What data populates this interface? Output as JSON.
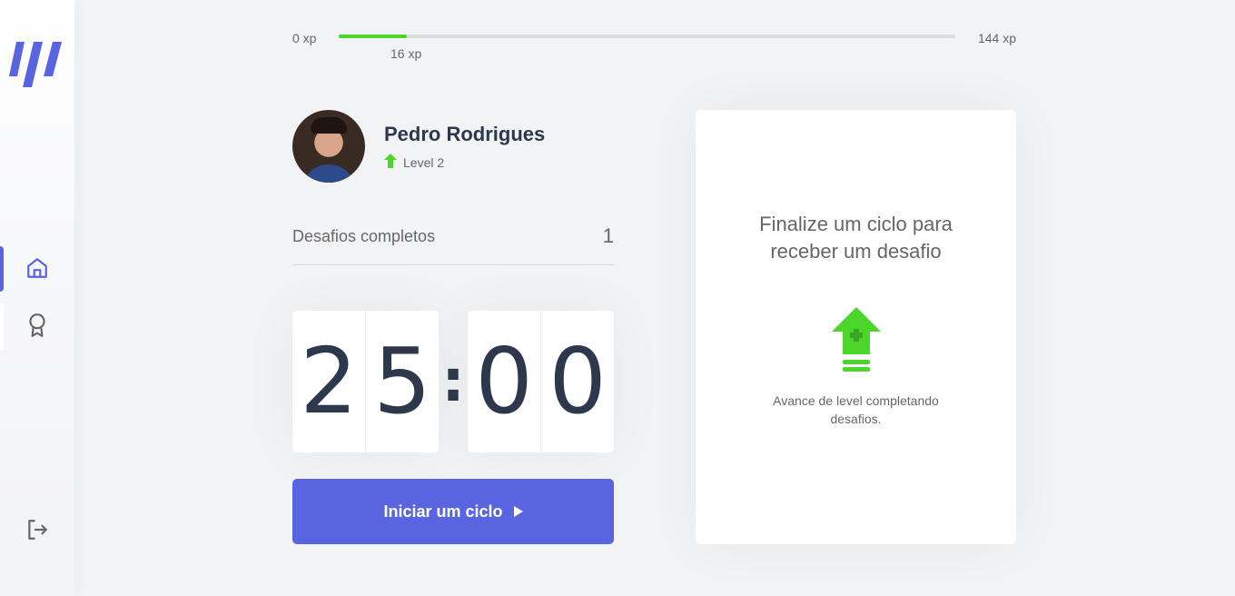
{
  "sidebar": {
    "logo": "app-logo",
    "items": [
      {
        "name": "home-icon",
        "active": true
      },
      {
        "name": "award-icon",
        "active": false
      }
    ],
    "logout": "logout-icon",
    "accent_color": "#5965e0"
  },
  "xp": {
    "min_label": "0 xp",
    "max_label": "144 xp",
    "current_label": "16 xp",
    "progress": 0.11,
    "fill_color": "#4cd62b"
  },
  "profile": {
    "name": "Pedro Rodrigues",
    "level": "Level 2",
    "level_icon": "level-up-icon"
  },
  "completed": {
    "label": "Desafios completos",
    "value": "1"
  },
  "countdown": {
    "minute_left": "2",
    "minute_right": "5",
    "separator": ":",
    "second_left": "0",
    "second_right": "0"
  },
  "start_button": {
    "label": "Iniciar um ciclo",
    "icon": "play-icon"
  },
  "challenge_box": {
    "title": "Finalize um ciclo para receber um desafio",
    "icon": "level-up-icon",
    "text": "Avance de level completando desafios."
  }
}
